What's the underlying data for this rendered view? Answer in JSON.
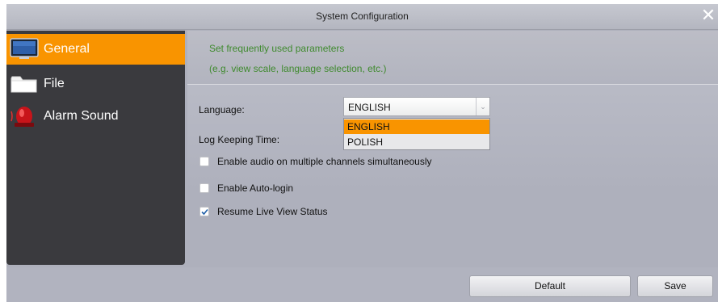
{
  "window": {
    "title": "System Configuration",
    "close_glyph": "✕"
  },
  "sidebar": {
    "items": [
      {
        "label": "General",
        "icon": "monitor-icon",
        "active": true
      },
      {
        "label": "File",
        "icon": "folder-icon",
        "active": false
      },
      {
        "label": "Alarm Sound",
        "icon": "alarm-siren-icon",
        "active": false
      }
    ]
  },
  "content": {
    "description": {
      "line1": "Set frequently used parameters",
      "line2": "(e.g. view scale, language selection, etc.)"
    },
    "language": {
      "label": "Language:",
      "value": "ENGLISH",
      "options": [
        "ENGLISH",
        "POLISH"
      ],
      "highlighted_option": "ENGLISH"
    },
    "log_keeping_time": {
      "label": "Log Keeping Time:"
    },
    "checkboxes": [
      {
        "label": "Enable audio on multiple channels simultaneously",
        "checked": false
      },
      {
        "label": "Enable Auto-login",
        "checked": false
      },
      {
        "label": "Resume Live View Status",
        "checked": true
      }
    ]
  },
  "footer": {
    "default_label": "Default",
    "save_label": "Save"
  },
  "colors": {
    "accent": "#f99400",
    "description_text": "#3f8a2e",
    "sidebar_bg": "#3a3a3e"
  }
}
